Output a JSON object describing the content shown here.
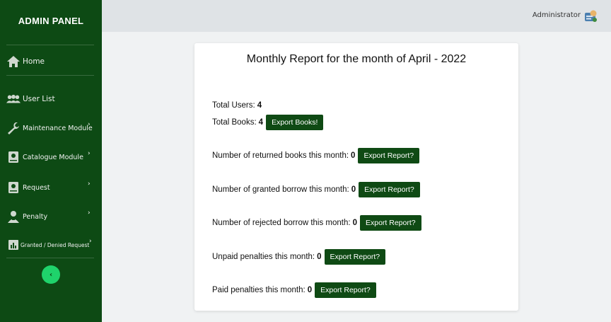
{
  "sidebar": {
    "brand": "ADMIN PANEL",
    "items": [
      {
        "label": "Home",
        "icon": "home-icon"
      },
      {
        "label": "User List",
        "icon": "users-icon"
      },
      {
        "label": "Maintenance Module",
        "icon": "wrench-icon"
      },
      {
        "label": "Catalogue Module",
        "icon": "book-icon"
      },
      {
        "label": "Request",
        "icon": "request-icon"
      },
      {
        "label": "Penalty",
        "icon": "penalty-icon"
      },
      {
        "label": "Granted / Denied Request",
        "icon": "chart-icon"
      }
    ],
    "collapse_glyph": "‹",
    "accent_color": "#1fd36b",
    "background_color": "#0d4a14"
  },
  "header": {
    "user_name": "Administrator",
    "avatar_icon": "avatar-icon"
  },
  "report": {
    "title": "Monthly Report for the month of April - 2022",
    "total_users_label": "Total Users:",
    "total_users": "4",
    "total_books_label": "Total Books:",
    "total_books": "4",
    "export_books_label": "Export Books!",
    "rows": [
      {
        "label": "Number of returned books this month:",
        "value": "0",
        "button": "Export Report?"
      },
      {
        "label": "Number of granted borrow this month:",
        "value": "0",
        "button": "Export Report?"
      },
      {
        "label": "Number of rejected borrow this month:",
        "value": "0",
        "button": "Export Report?"
      },
      {
        "label": "Unpaid penalties this month:",
        "value": "0",
        "button": "Export Report?"
      },
      {
        "label": "Paid penalties this month:",
        "value": "0",
        "button": "Export Report?"
      }
    ]
  }
}
